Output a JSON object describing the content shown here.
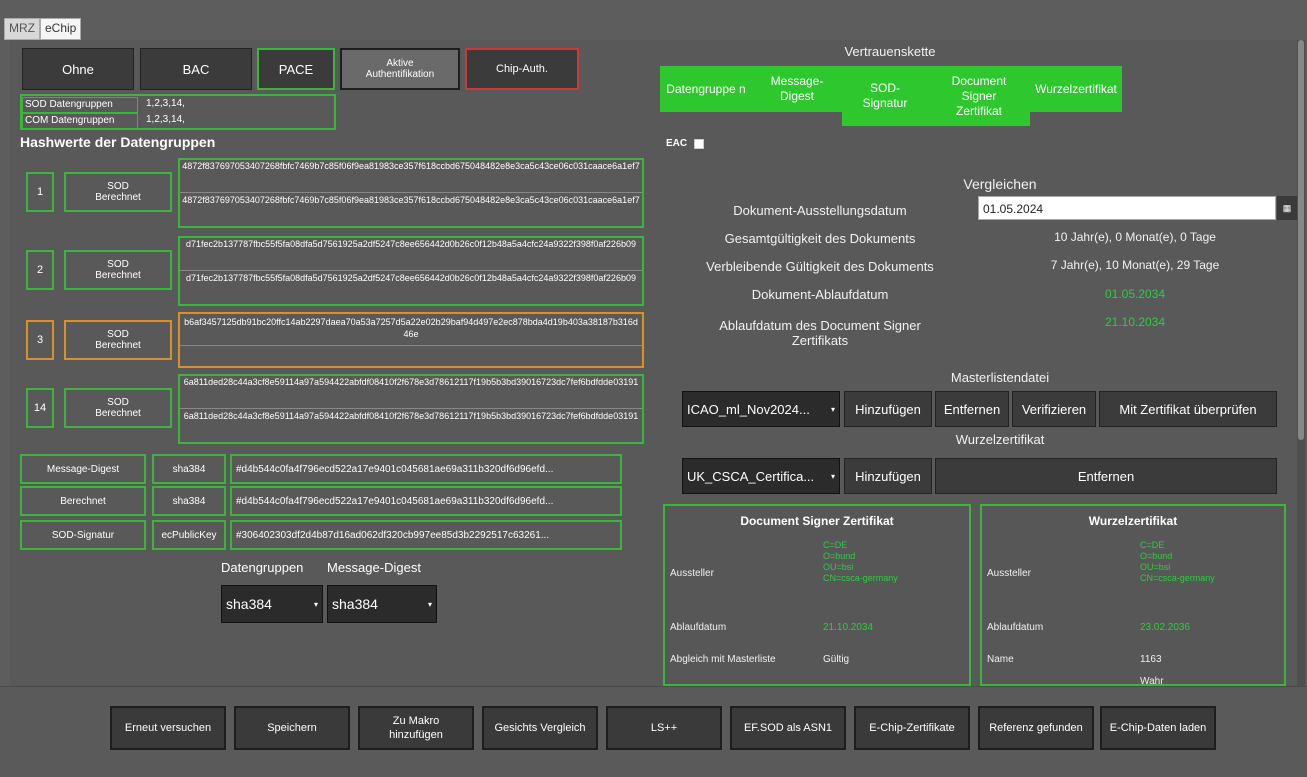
{
  "tabs": [
    "MRZ",
    "eChip"
  ],
  "auth_buttons": [
    "Ohne",
    "BAC",
    "PACE",
    "Aktive Authentifikation",
    "Chip-Auth."
  ],
  "sod": {
    "sod_label": "SOD Datengruppen",
    "sod_value": "1,2,3,14,",
    "com_label": "COM Datengruppen",
    "com_value": "1,2,3,14,"
  },
  "hash_title": "Hashwerte der Datengruppen",
  "groups": [
    {
      "num": "1",
      "label": "SOD Berechnet",
      "h1": "4872f837697053407268fbfc7469b7c85f06f9ea81983ce357f618ccbd675048482e8e3ca5c43ce06c031caace6a1ef7",
      "h2": "4872f837697053407268fbfc7469b7c85f06f9ea81983ce357f618ccbd675048482e8e3ca5c43ce06c031caace6a1ef7"
    },
    {
      "num": "2",
      "label": "SOD Berechnet",
      "h1": "d71fec2b137787fbc55f5fa08dfa5d7561925a2df5247c8ee656442d0b26c0f12b48a5a4cfc24a9322f398f0af226b09",
      "h2": "d71fec2b137787fbc55f5fa08dfa5d7561925a2df5247c8ee656442d0b26c0f12b48a5a4cfc24a9322f398f0af226b09"
    },
    {
      "num": "3",
      "label": "SOD Berechnet",
      "h1": "b6af3457125db91bc20ffc14ab2297daea70a53a7257d5a22e02b29baf94d497e2ec878bda4d19b403a38187b316d46e",
      "h2": ""
    },
    {
      "num": "14",
      "label": "SOD Berechnet",
      "h1": "6a811ded28c44a3cf8e59114a97a594422abfdf08410f2f678e3d78612117f19b5b3bd39016723dc7fef6bdfdde03191",
      "h2": "6a811ded28c44a3cf8e59114a97a594422abfdf08410f2f678e3d78612117f19b5b3bd39016723dc7fef6bdfdde03191"
    }
  ],
  "digests": [
    {
      "name": "Message-Digest",
      "algo": "sha384",
      "value": "#d4b544c0fa4f796ecd522a17e9401c045681ae69a311b320df6d96efd..."
    },
    {
      "name": "Berechnet",
      "algo": "sha384",
      "value": "#d4b544c0fa4f796ecd522a17e9401c045681ae69a311b320df6d96efd..."
    },
    {
      "name": "SOD-Signatur",
      "algo": "ecPublicKey",
      "value": "#306402303df2d4b87d16ad062df320cb997ee85d3b2292517c63261..."
    }
  ],
  "algo_select": {
    "dg_label": "Datengruppen",
    "md_label": "Message-Digest",
    "dg_value": "sha384",
    "md_value": "sha384"
  },
  "chain": {
    "title": "Vertrauenskette",
    "cells": [
      "Datengruppe n",
      "Message-Digest",
      "SOD-Signatur",
      "Document Signer Zertifikat",
      "Wurzelzertifikat"
    ]
  },
  "eac_label": "EAC",
  "compare": {
    "title": "Vergleichen",
    "issue_label": "Dokument-Ausstellungsdatum",
    "issue_value": "01.05.2024",
    "total_label": "Gesamtgültigkeit des Dokuments",
    "total_value": "10 Jahr(e), 0 Monat(e), 0 Tage",
    "remaining_label": "Verbleibende Gültigkeit des Dokuments",
    "remaining_value": "7 Jahr(e), 10 Monat(e), 29 Tage",
    "expiry_label": "Dokument-Ablaufdatum",
    "expiry_value": "01.05.2034",
    "ds_expiry_label": "Ablaufdatum des Document Signer Zertifikats",
    "ds_expiry_value": "21.10.2034"
  },
  "masterlist": {
    "title": "Masterlistendatei",
    "file": "ICAO_ml_Nov2024...",
    "add": "Hinzufügen",
    "remove": "Entfernen",
    "verify": "Verifizieren",
    "check": "Mit Zertifikat überprüfen"
  },
  "root": {
    "title": "Wurzelzertifikat",
    "file": "UK_CSCA_Certifica...",
    "add": "Hinzufügen",
    "remove": "Entfernen"
  },
  "ds_cert": {
    "title": "Document Signer Zertifikat",
    "issuer_label": "Aussteller",
    "issuer_lines": [
      "C=DE",
      "O=bund",
      "OU=bsi",
      "CN=csca-germany"
    ],
    "expiry_label": "Ablaufdatum",
    "expiry_value": "21.10.2034",
    "match_label": "Abgleich mit Masterliste",
    "match_value": "Gültig"
  },
  "root_cert": {
    "title": "Wurzelzertifikat",
    "issuer_label": "Aussteller",
    "issuer_lines": [
      "C=DE",
      "O=bund",
      "OU=bsi",
      "CN=csca-germany"
    ],
    "expiry_label": "Ablaufdatum",
    "expiry_value": "23.02.2036",
    "name_label": "Name",
    "name_value": "1163",
    "extra_value": "Wahr"
  },
  "bottom_buttons": [
    "Erneut versuchen",
    "Speichern",
    "Zu Makro hinzufügen",
    "Gesichts Vergleich",
    "LS++",
    "EF.SOD als ASN1",
    "E-Chip-Zertifikate",
    "Referenz gefunden",
    "E-Chip-Daten laden"
  ]
}
